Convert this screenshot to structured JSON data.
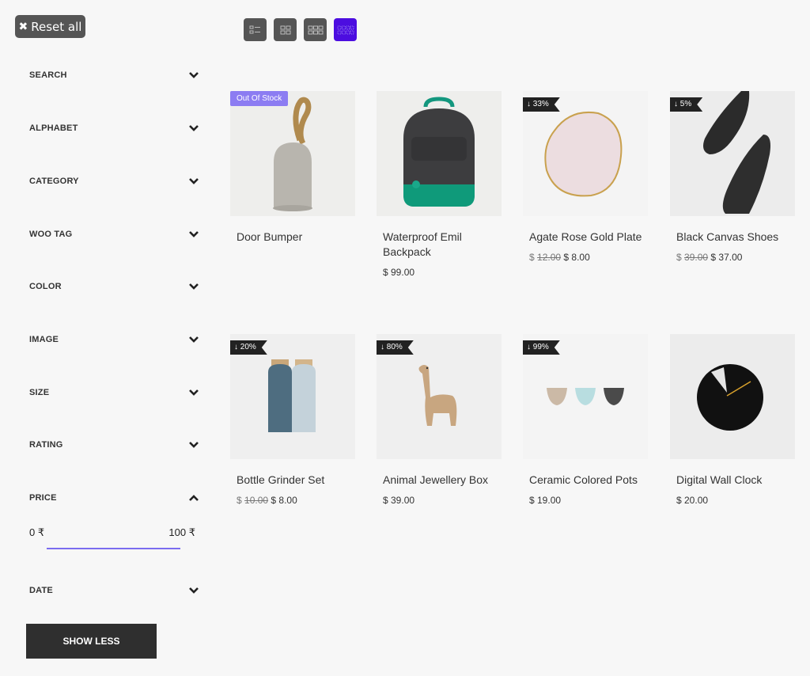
{
  "toolbar": {
    "reset_label": "Reset all",
    "view_modes": [
      {
        "name": "list",
        "active": false
      },
      {
        "name": "grid-2",
        "active": false
      },
      {
        "name": "grid-3",
        "active": false
      },
      {
        "name": "grid-4",
        "active": true
      }
    ],
    "active_color": "#4c0de0"
  },
  "sidebar": {
    "filters": [
      {
        "label": "SEARCH",
        "expanded": false
      },
      {
        "label": "ALPHABET",
        "expanded": false
      },
      {
        "label": "CATEGORY",
        "expanded": false
      },
      {
        "label": "WOO TAG",
        "expanded": false
      },
      {
        "label": "COLOR",
        "expanded": false
      },
      {
        "label": "IMAGE",
        "expanded": false
      },
      {
        "label": "SIZE",
        "expanded": false
      },
      {
        "label": "RATING",
        "expanded": false
      },
      {
        "label": "PRICE",
        "expanded": true
      },
      {
        "label": "DATE",
        "expanded": false
      }
    ],
    "price": {
      "min_label": "0 ₹",
      "max_label": "100 ₹",
      "min": 0,
      "max": 100
    },
    "show_less_label": "SHOW LESS"
  },
  "products": [
    {
      "name": "Door Bumper",
      "badge": "Out Of Stock",
      "badge_type": "oos",
      "old_price": null,
      "price": "$ ",
      "price_value": "",
      "image": "door-bumper"
    },
    {
      "name": "Waterproof Emil Backpack",
      "badge": null,
      "badge_type": null,
      "old_price": null,
      "price": "$ 99.00",
      "image": "backpack"
    },
    {
      "name": "Agate Rose Gold Plate",
      "badge": "↓ 33%",
      "badge_type": "sale",
      "currency": "$",
      "old_price": "12.00",
      "price": "$ 8.00",
      "image": "plate"
    },
    {
      "name": "Black Canvas Shoes",
      "badge": "↓ 5%",
      "badge_type": "sale",
      "currency": "$",
      "old_price": "39.00",
      "price": "$ 37.00",
      "image": "shoes"
    },
    {
      "name": "Bottle Grinder Set",
      "badge": "↓ 20%",
      "badge_type": "sale",
      "currency": "$",
      "old_price": "10.00",
      "price": "$ 8.00",
      "image": "grinder"
    },
    {
      "name": "Animal Jewellery Box",
      "badge": "↓ 80%",
      "badge_type": "sale",
      "old_price": null,
      "price": "$ 39.00",
      "image": "llama"
    },
    {
      "name": "Ceramic Colored Pots",
      "badge": "↓ 99%",
      "badge_type": "sale",
      "old_price": null,
      "price": "$ 19.00",
      "image": "pots"
    },
    {
      "name": "Digital Wall Clock",
      "badge": null,
      "badge_type": null,
      "old_price": null,
      "price": "$ 20.00",
      "image": "clock"
    }
  ]
}
